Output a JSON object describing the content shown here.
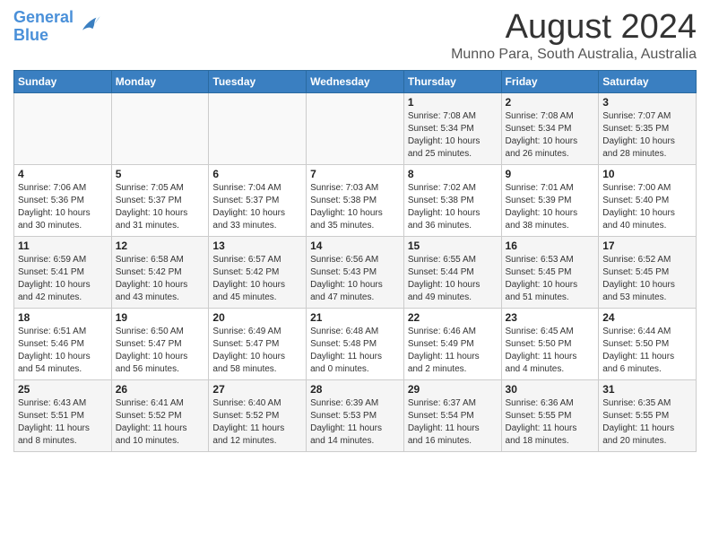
{
  "header": {
    "logo_line1": "General",
    "logo_line2": "Blue",
    "title": "August 2024",
    "subtitle": "Munno Para, South Australia, Australia"
  },
  "weekdays": [
    "Sunday",
    "Monday",
    "Tuesday",
    "Wednesday",
    "Thursday",
    "Friday",
    "Saturday"
  ],
  "weeks": [
    [
      {
        "day": "",
        "info": ""
      },
      {
        "day": "",
        "info": ""
      },
      {
        "day": "",
        "info": ""
      },
      {
        "day": "",
        "info": ""
      },
      {
        "day": "1",
        "info": "Sunrise: 7:08 AM\nSunset: 5:34 PM\nDaylight: 10 hours\nand 25 minutes."
      },
      {
        "day": "2",
        "info": "Sunrise: 7:08 AM\nSunset: 5:34 PM\nDaylight: 10 hours\nand 26 minutes."
      },
      {
        "day": "3",
        "info": "Sunrise: 7:07 AM\nSunset: 5:35 PM\nDaylight: 10 hours\nand 28 minutes."
      }
    ],
    [
      {
        "day": "4",
        "info": "Sunrise: 7:06 AM\nSunset: 5:36 PM\nDaylight: 10 hours\nand 30 minutes."
      },
      {
        "day": "5",
        "info": "Sunrise: 7:05 AM\nSunset: 5:37 PM\nDaylight: 10 hours\nand 31 minutes."
      },
      {
        "day": "6",
        "info": "Sunrise: 7:04 AM\nSunset: 5:37 PM\nDaylight: 10 hours\nand 33 minutes."
      },
      {
        "day": "7",
        "info": "Sunrise: 7:03 AM\nSunset: 5:38 PM\nDaylight: 10 hours\nand 35 minutes."
      },
      {
        "day": "8",
        "info": "Sunrise: 7:02 AM\nSunset: 5:38 PM\nDaylight: 10 hours\nand 36 minutes."
      },
      {
        "day": "9",
        "info": "Sunrise: 7:01 AM\nSunset: 5:39 PM\nDaylight: 10 hours\nand 38 minutes."
      },
      {
        "day": "10",
        "info": "Sunrise: 7:00 AM\nSunset: 5:40 PM\nDaylight: 10 hours\nand 40 minutes."
      }
    ],
    [
      {
        "day": "11",
        "info": "Sunrise: 6:59 AM\nSunset: 5:41 PM\nDaylight: 10 hours\nand 42 minutes."
      },
      {
        "day": "12",
        "info": "Sunrise: 6:58 AM\nSunset: 5:42 PM\nDaylight: 10 hours\nand 43 minutes."
      },
      {
        "day": "13",
        "info": "Sunrise: 6:57 AM\nSunset: 5:42 PM\nDaylight: 10 hours\nand 45 minutes."
      },
      {
        "day": "14",
        "info": "Sunrise: 6:56 AM\nSunset: 5:43 PM\nDaylight: 10 hours\nand 47 minutes."
      },
      {
        "day": "15",
        "info": "Sunrise: 6:55 AM\nSunset: 5:44 PM\nDaylight: 10 hours\nand 49 minutes."
      },
      {
        "day": "16",
        "info": "Sunrise: 6:53 AM\nSunset: 5:45 PM\nDaylight: 10 hours\nand 51 minutes."
      },
      {
        "day": "17",
        "info": "Sunrise: 6:52 AM\nSunset: 5:45 PM\nDaylight: 10 hours\nand 53 minutes."
      }
    ],
    [
      {
        "day": "18",
        "info": "Sunrise: 6:51 AM\nSunset: 5:46 PM\nDaylight: 10 hours\nand 54 minutes."
      },
      {
        "day": "19",
        "info": "Sunrise: 6:50 AM\nSunset: 5:47 PM\nDaylight: 10 hours\nand 56 minutes."
      },
      {
        "day": "20",
        "info": "Sunrise: 6:49 AM\nSunset: 5:47 PM\nDaylight: 10 hours\nand 58 minutes."
      },
      {
        "day": "21",
        "info": "Sunrise: 6:48 AM\nSunset: 5:48 PM\nDaylight: 11 hours\nand 0 minutes."
      },
      {
        "day": "22",
        "info": "Sunrise: 6:46 AM\nSunset: 5:49 PM\nDaylight: 11 hours\nand 2 minutes."
      },
      {
        "day": "23",
        "info": "Sunrise: 6:45 AM\nSunset: 5:50 PM\nDaylight: 11 hours\nand 4 minutes."
      },
      {
        "day": "24",
        "info": "Sunrise: 6:44 AM\nSunset: 5:50 PM\nDaylight: 11 hours\nand 6 minutes."
      }
    ],
    [
      {
        "day": "25",
        "info": "Sunrise: 6:43 AM\nSunset: 5:51 PM\nDaylight: 11 hours\nand 8 minutes."
      },
      {
        "day": "26",
        "info": "Sunrise: 6:41 AM\nSunset: 5:52 PM\nDaylight: 11 hours\nand 10 minutes."
      },
      {
        "day": "27",
        "info": "Sunrise: 6:40 AM\nSunset: 5:52 PM\nDaylight: 11 hours\nand 12 minutes."
      },
      {
        "day": "28",
        "info": "Sunrise: 6:39 AM\nSunset: 5:53 PM\nDaylight: 11 hours\nand 14 minutes."
      },
      {
        "day": "29",
        "info": "Sunrise: 6:37 AM\nSunset: 5:54 PM\nDaylight: 11 hours\nand 16 minutes."
      },
      {
        "day": "30",
        "info": "Sunrise: 6:36 AM\nSunset: 5:55 PM\nDaylight: 11 hours\nand 18 minutes."
      },
      {
        "day": "31",
        "info": "Sunrise: 6:35 AM\nSunset: 5:55 PM\nDaylight: 11 hours\nand 20 minutes."
      }
    ]
  ]
}
